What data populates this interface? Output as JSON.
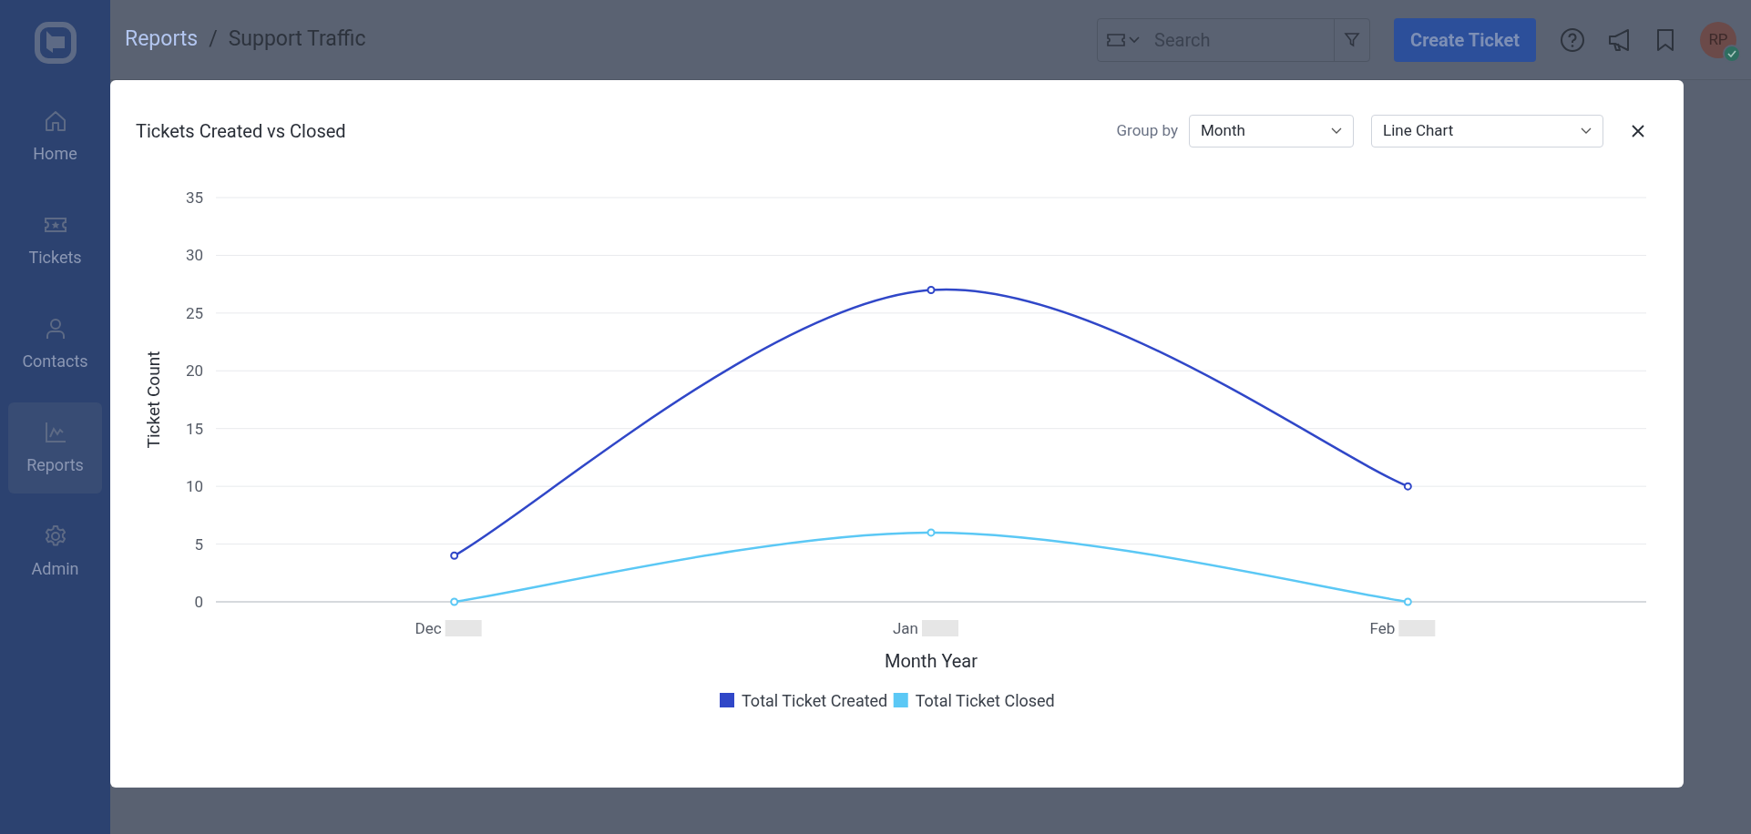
{
  "sidebar": {
    "items": [
      {
        "label": "Home",
        "selected": false
      },
      {
        "label": "Tickets",
        "selected": false
      },
      {
        "label": "Contacts",
        "selected": false
      },
      {
        "label": "Reports",
        "selected": true
      },
      {
        "label": "Admin",
        "selected": false
      }
    ]
  },
  "breadcrumb": [
    "Reports",
    "/",
    "Support Traffic"
  ],
  "search": {
    "placeholder": "Search"
  },
  "create_button": "Create Ticket",
  "avatar": {
    "initials": "RP",
    "online": true
  },
  "modal": {
    "title": "Tickets Created vs Closed",
    "group_by_label": "Group by",
    "group_by": "Month",
    "chart_type": "Line Chart",
    "chart_data": {
      "type": "line",
      "grid": true,
      "legend": true,
      "xlabel": "Month Year",
      "ylabel": "Ticket Count",
      "categories": [
        "Dec",
        "Jan",
        "Feb"
      ],
      "ylim": [
        0,
        35
      ],
      "yticks": [
        0,
        5,
        10,
        15,
        20,
        25,
        30,
        35
      ],
      "series": [
        {
          "name": "Total Ticket Created",
          "color": "#3047c8",
          "marker": "circle",
          "values": [
            4,
            27,
            10
          ]
        },
        {
          "name": "Total Ticket Closed",
          "color": "#5bc8f5",
          "marker": "circle",
          "values": [
            0,
            6,
            0
          ]
        }
      ]
    }
  }
}
